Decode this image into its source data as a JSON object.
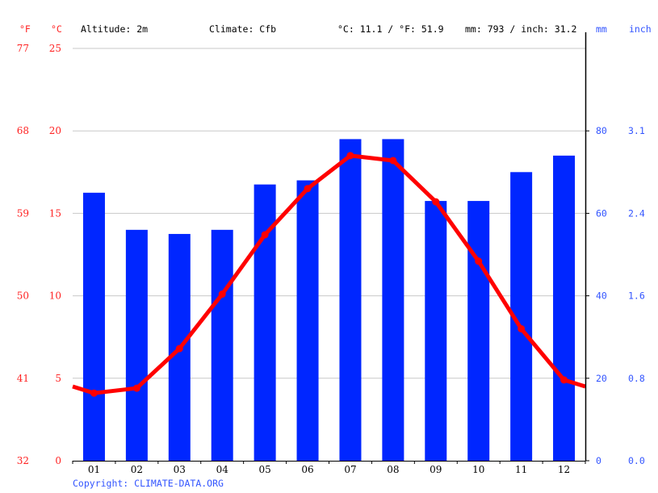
{
  "header": {
    "unit_f": "°F",
    "unit_c": "°C",
    "altitude": "Altitude: 2m",
    "climate": "Climate: Cfb",
    "temp_summary": "°C: 11.1 / °F: 51.9",
    "precip_summary": "mm: 793 / inch: 31.2",
    "unit_mm": "mm",
    "unit_inch": "inch"
  },
  "footer": {
    "copyright": "Copyright: CLIMATE-DATA.ORG"
  },
  "colors": {
    "temperature": "#ff0000",
    "precipitation": "#0026ff",
    "grid": "#c8c8c8",
    "axis": "#000000",
    "label_blue": "#3355ff",
    "label_red": "#ff2222"
  },
  "chart_data": {
    "type": "bar+line",
    "title": "",
    "categories": [
      "01",
      "02",
      "03",
      "04",
      "05",
      "06",
      "07",
      "08",
      "09",
      "10",
      "11",
      "12"
    ],
    "series": [
      {
        "name": "Precipitation (mm)",
        "type": "bar",
        "axis": "right",
        "values": [
          65,
          56,
          55,
          56,
          67,
          68,
          78,
          78,
          63,
          63,
          70,
          74
        ]
      },
      {
        "name": "Temperature (°C)",
        "type": "line",
        "axis": "left",
        "values": [
          4.1,
          4.4,
          6.8,
          10.1,
          13.7,
          16.5,
          18.5,
          18.2,
          15.7,
          12.1,
          8.0,
          4.9
        ],
        "edge_start": 4.5,
        "edge_end": 4.5
      }
    ],
    "left_axis_c": {
      "ticks": [
        0,
        5,
        10,
        15,
        20,
        25
      ],
      "ylim": [
        0,
        25
      ]
    },
    "left_axis_f": {
      "ticks": [
        32,
        41,
        50,
        59,
        68,
        77
      ]
    },
    "right_axis_mm": {
      "ticks": [
        0,
        20,
        40,
        60,
        80
      ],
      "ylim": [
        0,
        100
      ]
    },
    "right_axis_inch": {
      "ticks": [
        "0.0",
        "0.8",
        "1.6",
        "2.4",
        "3.1"
      ]
    },
    "grid": true
  }
}
